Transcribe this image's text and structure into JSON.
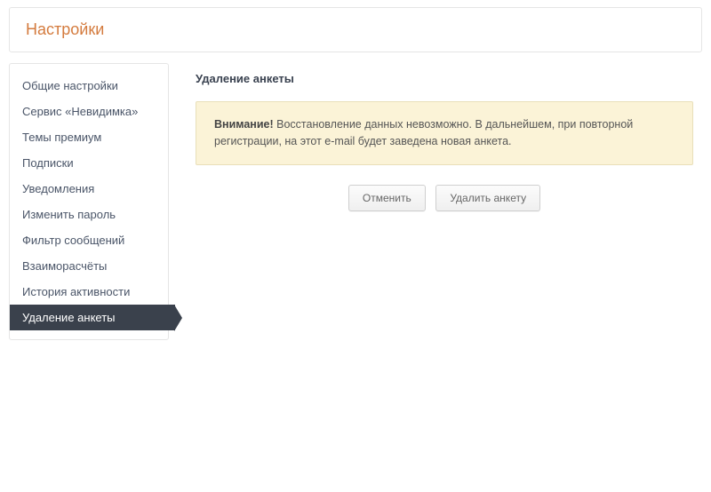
{
  "page": {
    "title": "Настройки"
  },
  "sidebar": {
    "items": [
      {
        "label": "Общие настройки",
        "active": false
      },
      {
        "label": "Сервис «Невидимка»",
        "active": false
      },
      {
        "label": "Темы премиум",
        "active": false
      },
      {
        "label": "Подписки",
        "active": false
      },
      {
        "label": "Уведомления",
        "active": false
      },
      {
        "label": "Изменить пароль",
        "active": false
      },
      {
        "label": "Фильтр сообщений",
        "active": false
      },
      {
        "label": "Взаиморасчёты",
        "active": false
      },
      {
        "label": "История активности",
        "active": false
      },
      {
        "label": "Удаление анкеты",
        "active": true
      }
    ]
  },
  "main": {
    "section_title": "Удаление анкеты",
    "warning": {
      "strong": "Внимание!",
      "text": " Восстановление данных невозможно. В дальнейшем, при повторной регистрации, на этот e-mail будет заведена новая анкета."
    },
    "buttons": {
      "cancel": "Отменить",
      "delete": "Удалить анкету"
    }
  }
}
